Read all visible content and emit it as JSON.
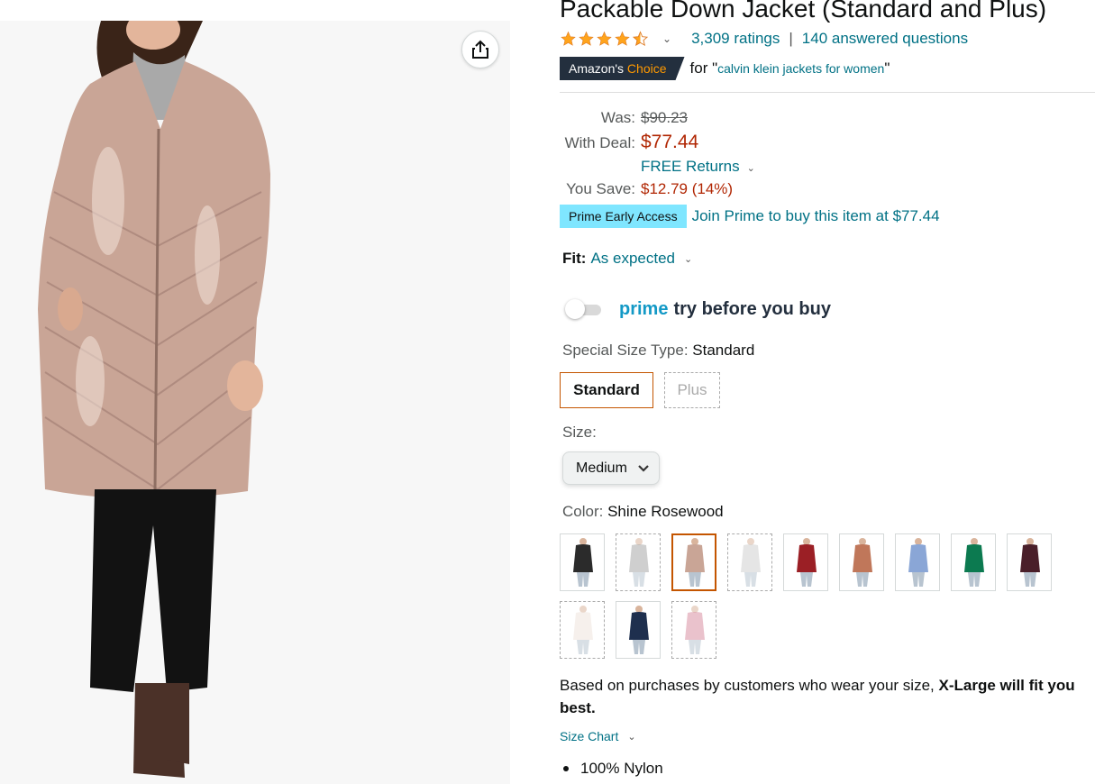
{
  "product": {
    "title": "Packable Down Jacket (Standard and Plus)"
  },
  "rating": {
    "stars": 4.5,
    "ratings_count": "3,309 ratings",
    "separator": "|",
    "answered_questions": "140 answered questions",
    "star_color": "#ffa41c"
  },
  "amazon_choice": {
    "badge_prefix": "Amazon's",
    "badge_accent": "Choice",
    "for_text": "for \"",
    "query": "calvin klein jackets for women",
    "close_quote": "\""
  },
  "pricing": {
    "was_label": "Was:",
    "was_value": "$90.23",
    "deal_label": "With Deal:",
    "deal_value": "$77.44",
    "returns": "FREE Returns",
    "save_label": "You Save:",
    "save_value": "$12.79 (14%)",
    "price_color": "#b12704"
  },
  "prime_early": {
    "badge": "Prime Early Access",
    "link": "Join Prime to buy this item at $77.44",
    "badge_color": "#7fe6ff"
  },
  "fit": {
    "label": "Fit:",
    "value": "As expected"
  },
  "try_before": {
    "prime": "prime",
    "text": "try before you buy",
    "enabled": false
  },
  "special_size": {
    "label": "Special Size Type: ",
    "selected": "Standard",
    "options": [
      "Standard",
      "Plus"
    ]
  },
  "size": {
    "label": "Size:",
    "selected": "Medium"
  },
  "color": {
    "label": "Color: ",
    "selected": "Shine Rosewood",
    "swatches": [
      {
        "name": "black",
        "coat": "#2b2b2b",
        "available": true
      },
      {
        "name": "silver",
        "coat": "#a8a8a8",
        "available": false
      },
      {
        "name": "shine-rosewood",
        "coat": "#c9a596",
        "available": true,
        "selected": true
      },
      {
        "name": "light-silver",
        "coat": "#cfcfcf",
        "available": false
      },
      {
        "name": "red",
        "coat": "#9b1f25",
        "available": true
      },
      {
        "name": "rust",
        "coat": "#c0775a",
        "available": true
      },
      {
        "name": "blue",
        "coat": "#8aa6d6",
        "available": true
      },
      {
        "name": "green",
        "coat": "#0c7a50",
        "available": true
      },
      {
        "name": "burgundy",
        "coat": "#4a1f2a",
        "available": true
      },
      {
        "name": "cream",
        "coat": "#eee4dc",
        "available": false
      },
      {
        "name": "navy",
        "coat": "#1e2f4e",
        "available": true
      },
      {
        "name": "pink",
        "coat": "#d88fa2",
        "available": false
      }
    ]
  },
  "fit_recommendation": {
    "prefix": "Based on purchases by customers who wear your size, ",
    "bold": "X-Large will fit you best."
  },
  "size_chart": "Size Chart",
  "bullets": [
    "100% Nylon"
  ],
  "accent_colors": {
    "link": "#007185",
    "selected_border": "#c45500",
    "prime_blue": "#1399c6",
    "choice_badge": "#232f3e"
  }
}
